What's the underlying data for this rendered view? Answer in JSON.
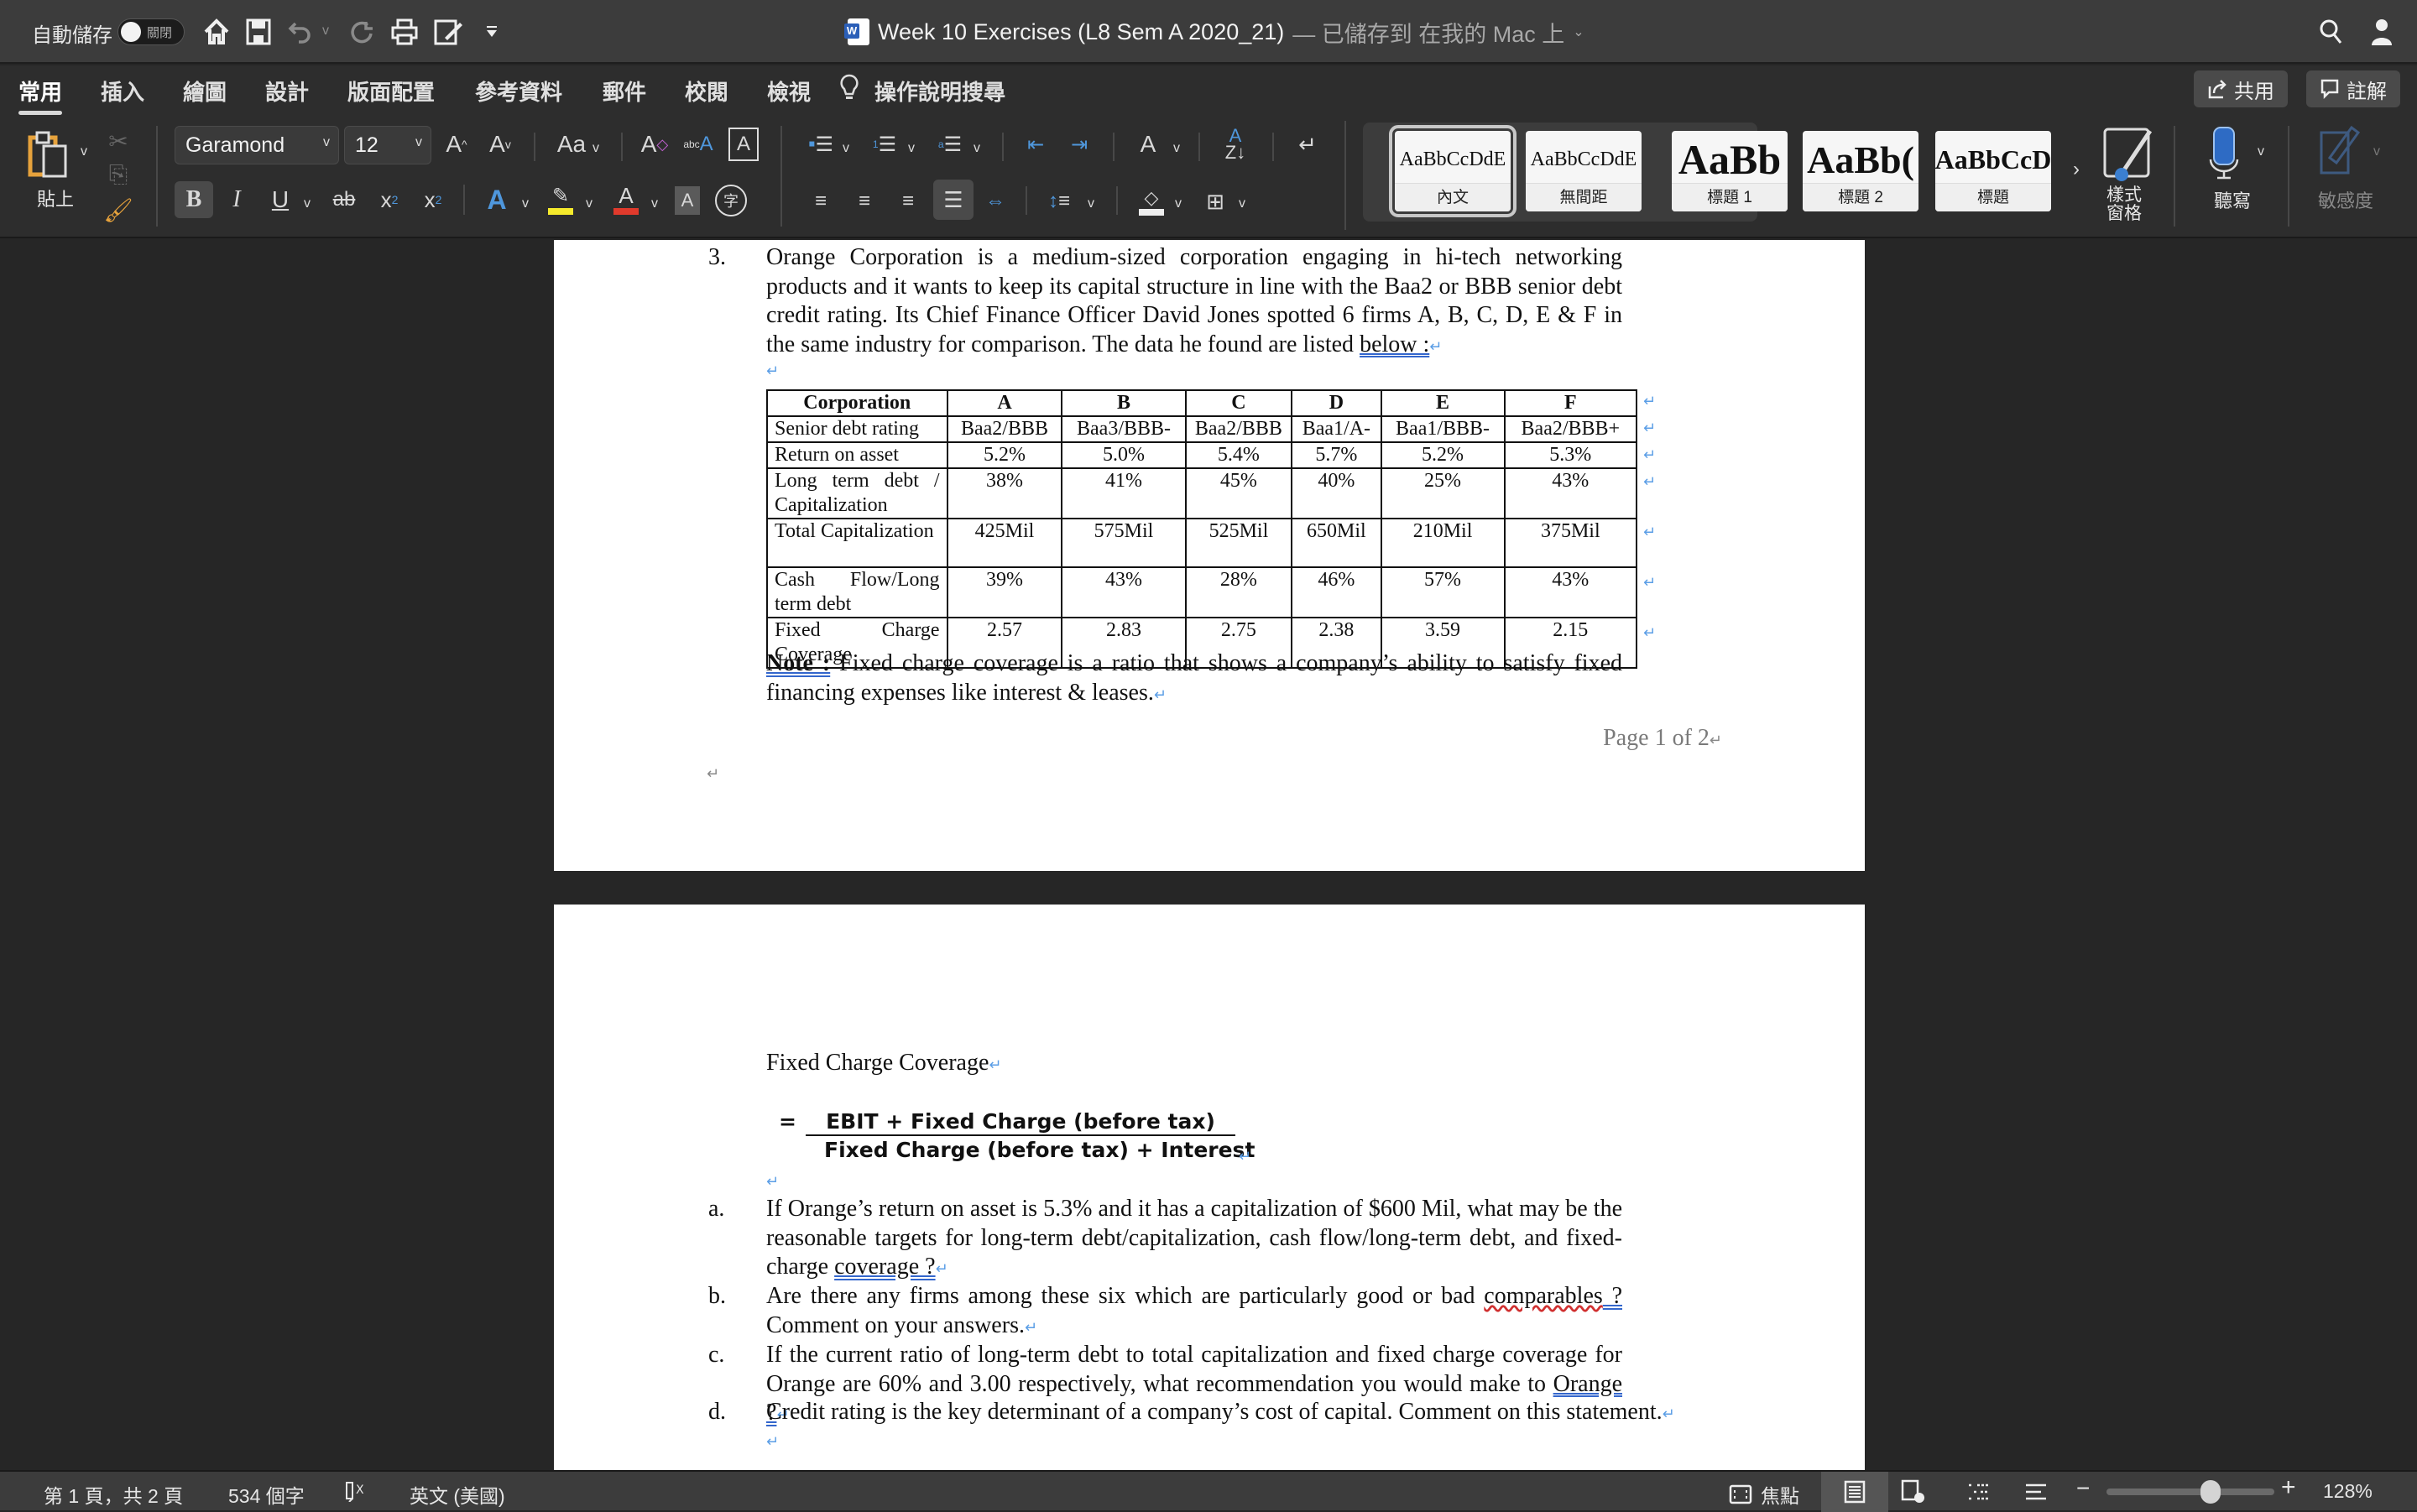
{
  "titlebar": {
    "autosave_label": "自動儲存",
    "autosave_state": "關閉",
    "doc_name": "Week 10 Exercises (L8 Sem A 2020_21)",
    "save_status": "— 已儲存到 在我的 Mac 上",
    "icons": [
      "home-icon",
      "save-icon",
      "undo-icon",
      "redo-icon",
      "print-icon",
      "edit-doc-icon",
      "customize-toolbar-icon",
      "search-icon",
      "account-icon"
    ]
  },
  "ribbon_tabs": [
    {
      "label": "常用",
      "active": true
    },
    {
      "label": "插入"
    },
    {
      "label": "繪圖"
    },
    {
      "label": "設計"
    },
    {
      "label": "版面配置"
    },
    {
      "label": "參考資料"
    },
    {
      "label": "郵件"
    },
    {
      "label": "校閱"
    },
    {
      "label": "檢視"
    },
    {
      "label": "操作說明搜尋"
    }
  ],
  "share_label": "共用",
  "comments_label": "註解",
  "ribbon": {
    "paste_label": "貼上",
    "font_name": "Garamond",
    "font_size": "12",
    "styles": [
      {
        "sample": "AaBbCcDdE",
        "name": "內文",
        "selected": true
      },
      {
        "sample": "AaBbCcDdE",
        "name": "無間距"
      },
      {
        "sample": "AaBb",
        "name": "標題 1"
      },
      {
        "sample": "AaBb(",
        "name": "標題 2"
      },
      {
        "sample": "AaBbCcD",
        "name": "標題"
      }
    ],
    "styles_pane_label": "樣式\n窗格",
    "dictate_label": "聽寫",
    "sensitivity_label": "敏感度"
  },
  "document": {
    "page1": {
      "q_number": "3.",
      "q_text": "Orange Corporation is a medium-sized corporation engaging in hi-tech networking products and it wants to keep its capital structure in line with the Baa2 or BBB senior debt credit rating. Its Chief Finance Officer David Jones spotted 6 firms A, B, C, D, E & F in the same industry for comparison.  The data he found are listed",
      "q_text_tail": "below :",
      "table": {
        "headers": [
          "Corporation",
          "A",
          "B",
          "C",
          "D",
          "E",
          "F"
        ],
        "rows": [
          [
            "Senior debt rating",
            "Baa2/BBB",
            "Baa3/BBB-",
            "Baa2/BBB",
            "Baa1/A-",
            "Baa1/BBB-",
            "Baa2/BBB+"
          ],
          [
            "Return on asset",
            "5.2%",
            "5.0%",
            "5.4%",
            "5.7%",
            "5.2%",
            "5.3%"
          ],
          [
            "Long term debt / Capitalization",
            "38%",
            "41%",
            "45%",
            "40%",
            "25%",
            "43%"
          ],
          [
            "Total Capitalization",
            "425Mil",
            "575Mil",
            "525Mil",
            "650Mil",
            "210Mil",
            "375Mil"
          ],
          [
            "Cash Flow/Long term debt",
            "39%",
            "43%",
            "28%",
            "46%",
            "57%",
            "43%"
          ],
          [
            "Fixed Charge Coverage",
            "2.57",
            "2.83",
            "2.75",
            "2.38",
            "3.59",
            "2.15"
          ]
        ]
      },
      "note_label": "Note :",
      "note_text": " Fixed charge coverage is a ratio that shows a company’s ability to satisfy fixed financing expenses like interest & leases.",
      "footer": "Page 1 of 2"
    },
    "page2": {
      "fcc_heading": "Fixed Charge Coverage",
      "formula_eq": "=",
      "formula_numerator": "EBIT + Fixed Charge (before tax)",
      "formula_denominator": "Fixed Charge (before tax) + Interest",
      "questions": [
        {
          "label": "a.",
          "text": "If Orange’s return on asset is 5.3% and it has a capitalization of $600 Mil, what may be the reasonable targets for long-term debt/capitalization, cash flow/long-term debt, and fixed-charge",
          "tail": "coverage ?"
        },
        {
          "label": "b.",
          "text_pre": "Are there any firms among these six which are particularly good or bad",
          "spell": "comparables",
          "text_mid": " ?",
          "text_post": "  Comment on your answers."
        },
        {
          "label": "c.",
          "text": "If the current ratio of long-term debt to total capitalization and fixed charge coverage for Orange are 60% and 3.00 respectively, what recommendation you would make to",
          "tail": "Orange ?"
        },
        {
          "label": "d.",
          "text": "Credit rating is the key determinant of a company’s cost of capital.  Comment on this statement."
        }
      ]
    }
  },
  "statusbar": {
    "page_info": "第 1 頁，共 2 頁",
    "word_count": "534 個字",
    "language": "英文 (美國)",
    "focus_label": "焦點",
    "zoom_level": "128%",
    "zoom_slider_fraction": 0.62
  }
}
